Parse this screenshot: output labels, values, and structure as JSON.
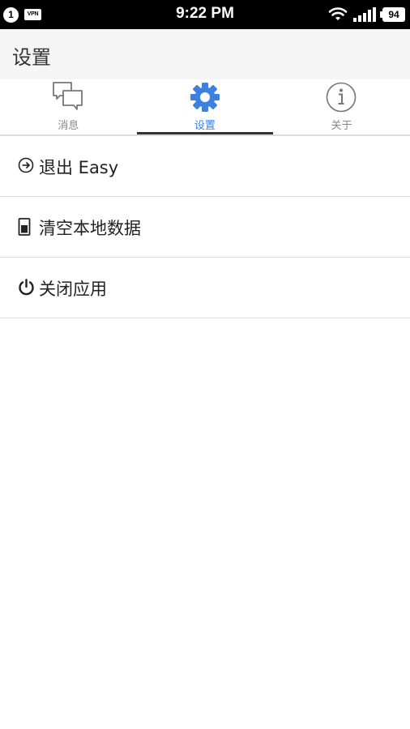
{
  "status_bar": {
    "notification_count": "1",
    "vpn_label": "VPN",
    "time": "9:22 PM",
    "battery": "94",
    "icons": [
      "wifi-icon",
      "signal-icon",
      "battery-icon"
    ]
  },
  "header": {
    "title": "设置"
  },
  "tabs": [
    {
      "label": "消息",
      "icon": "chat-bubbles-icon",
      "active": false
    },
    {
      "label": "设置",
      "icon": "gear-icon",
      "active": true
    },
    {
      "label": "关于",
      "icon": "info-icon",
      "active": false
    }
  ],
  "menu": [
    {
      "label": "退出 Easy",
      "icon": "logout-icon"
    },
    {
      "label": "清空本地数据",
      "icon": "storage-icon"
    },
    {
      "label": "关闭应用",
      "icon": "power-icon"
    }
  ],
  "colors": {
    "accent": "#3b82e0",
    "status_bar": "#000000",
    "header_bg": "#f5f5f5",
    "inactive_tab": "#888888"
  }
}
